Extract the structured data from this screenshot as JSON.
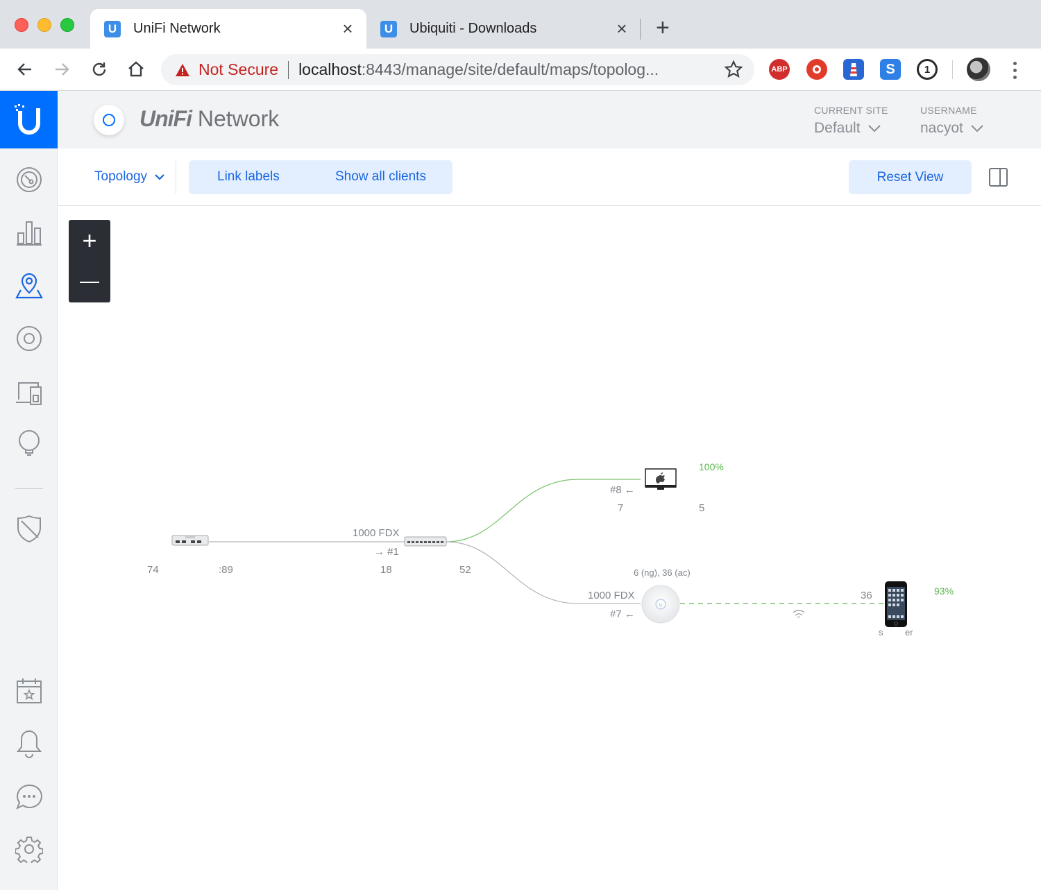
{
  "browser": {
    "tabs": [
      {
        "title": "UniFi Network",
        "favicon": "U",
        "active": true
      },
      {
        "title": "Ubiquiti - Downloads",
        "favicon": "U",
        "active": false
      }
    ],
    "security": "Not Secure",
    "url_host": "localhost",
    "url_rest": ":8443/manage/site/default/maps/topolog...",
    "extensions": [
      "ABP",
      "lastpass-icon",
      "lighthouse-icon",
      "S",
      "1password-icon"
    ]
  },
  "header": {
    "app_name_brand": "UniFi",
    "app_name": "Network",
    "current_site_label": "CURRENT SITE",
    "current_site_value": "Default",
    "username_label": "USERNAME",
    "username_value": "nacyot"
  },
  "subbar": {
    "view": "Topology",
    "link_labels": "Link labels",
    "show_all_clients": "Show all clients",
    "reset_view": "Reset View"
  },
  "sidebar": {
    "items": [
      "dashboard-icon",
      "statistics-icon",
      "map-icon",
      "devices-icon",
      "clients-icon",
      "insights-icon",
      "security-icon",
      "events-icon",
      "alerts-icon",
      "chat-icon",
      "settings-icon"
    ],
    "active": "map-icon"
  },
  "topology": {
    "gateway": {
      "label_left": "74",
      "label_right": ":89"
    },
    "switch": {
      "label_left": "18",
      "label_right": "52",
      "link_speed": "1000  FDX",
      "uplink_port": "→ #1"
    },
    "mac_client": {
      "port": "#8 ←",
      "label_left": "7",
      "label_right": "5",
      "signal": "100%"
    },
    "access_point": {
      "channels": "6 (ng), 36 (ac)",
      "link_speed": "1000  FDX",
      "port": "#7 ←"
    },
    "phone_client": {
      "channel": "36",
      "signal": "93%",
      "label_left": "s",
      "label_right": "er"
    },
    "colors": {
      "wired_active": "#7cc46e",
      "wired": "#b0b3b7",
      "wireless": "#7cc46e"
    }
  }
}
